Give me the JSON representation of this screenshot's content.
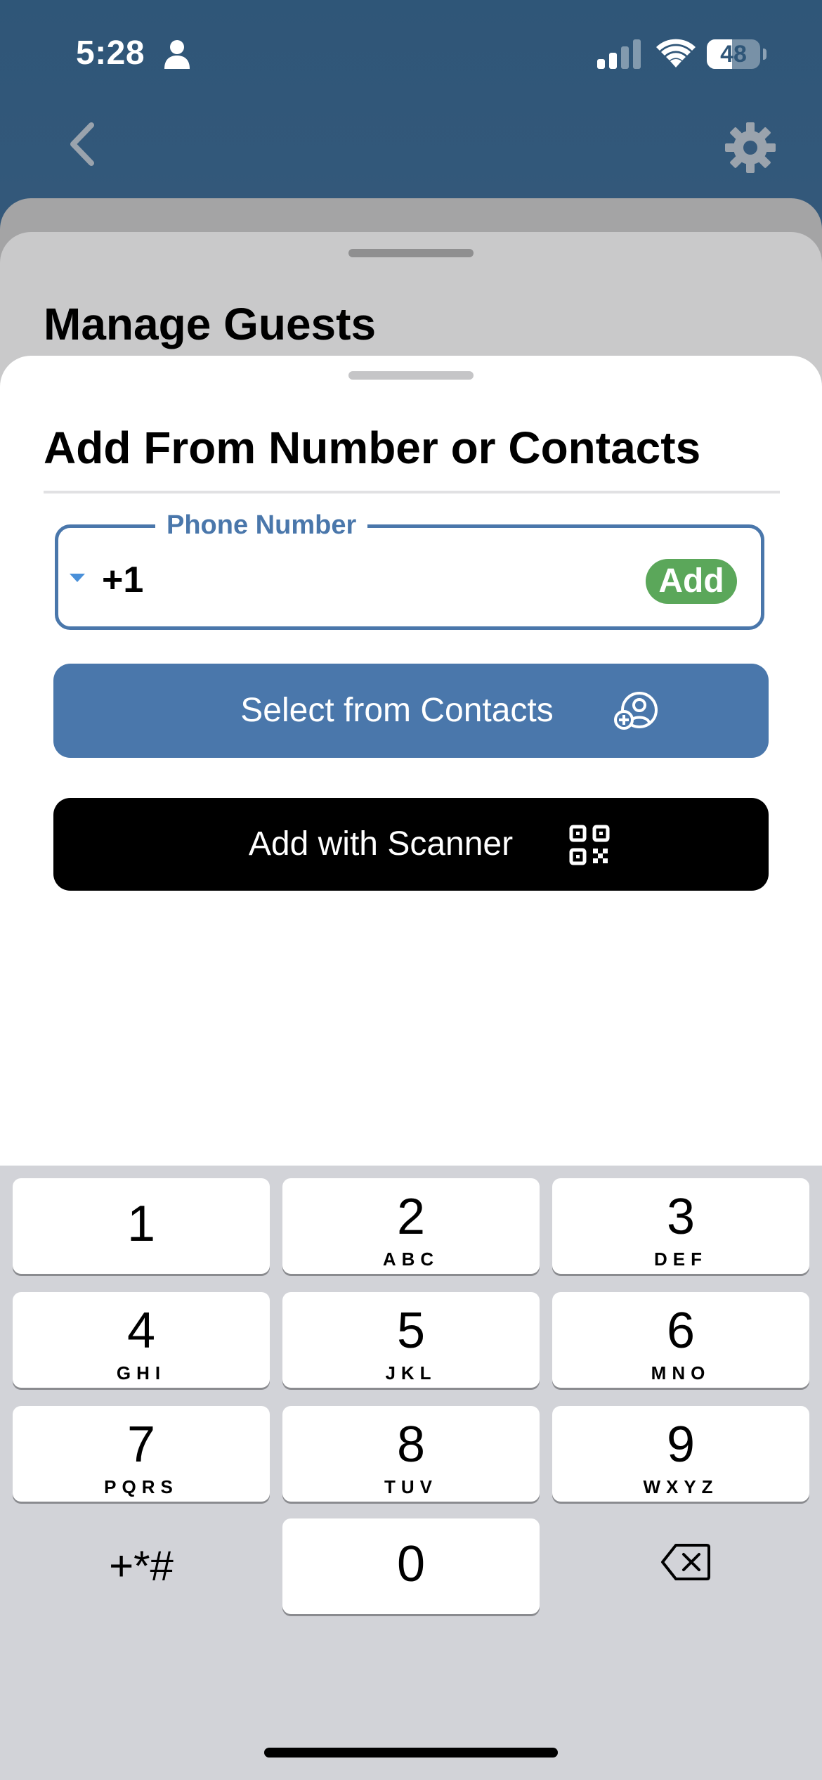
{
  "status_bar": {
    "time": "5:28",
    "battery": "48",
    "battery_percent": 48
  },
  "nav": {
    "back_icon": "chevron-left-icon",
    "settings_icon": "gear-icon"
  },
  "background_sheet": {
    "title": "Manage Guests"
  },
  "sheet": {
    "title": "Add From Number or Contacts",
    "phone_field": {
      "label": "Phone Number",
      "country_code": "+1",
      "value": "",
      "add_label": "Add"
    },
    "contacts_button": {
      "label": "Select from Contacts",
      "icon": "add-contact-icon"
    },
    "scanner_button": {
      "label": "Add with Scanner",
      "icon": "qr-code-icon"
    }
  },
  "keyboard": {
    "keys": [
      {
        "digit": "1",
        "letters": ""
      },
      {
        "digit": "2",
        "letters": "ABC"
      },
      {
        "digit": "3",
        "letters": "DEF"
      },
      {
        "digit": "4",
        "letters": "GHI"
      },
      {
        "digit": "5",
        "letters": "JKL"
      },
      {
        "digit": "6",
        "letters": "MNO"
      },
      {
        "digit": "7",
        "letters": "PQRS"
      },
      {
        "digit": "8",
        "letters": "TUV"
      },
      {
        "digit": "9",
        "letters": "WXYZ"
      },
      {
        "digit": "0",
        "letters": ""
      }
    ],
    "symbols": "+*#",
    "delete_icon": "backspace-icon"
  },
  "colors": {
    "header": "#2f5678",
    "accent": "#4a77ab",
    "add_green": "#5ba75a",
    "scanner_bg": "#000000"
  }
}
